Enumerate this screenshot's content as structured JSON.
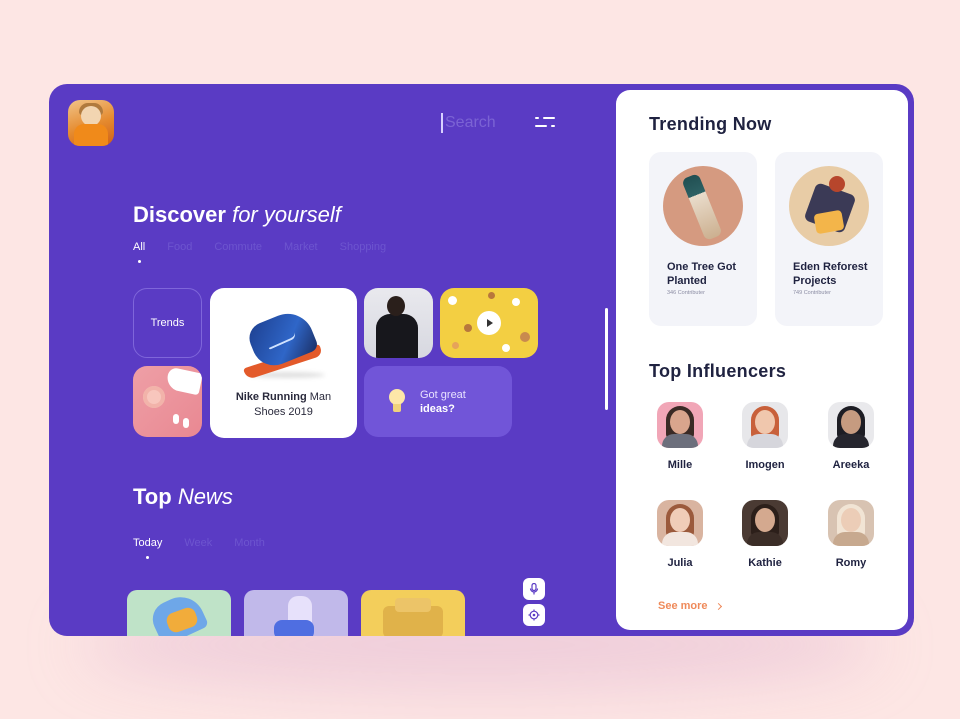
{
  "search": {
    "placeholder": "Search"
  },
  "discover": {
    "title_bold": "Discover",
    "title_italic": "for yourself",
    "tabs": [
      "All",
      "Food",
      "Commute",
      "Market",
      "Shopping"
    ],
    "active_tab": "All"
  },
  "cards": {
    "trends_label": "Trends",
    "nike_bold": "Nike Running",
    "nike_rest": "Man Shoes 2019",
    "ideas_line1": "Got great",
    "ideas_line2": "ideas?"
  },
  "news": {
    "title_bold": "Top",
    "title_italic": "News",
    "tabs": [
      "Today",
      "Week",
      "Month"
    ],
    "active_tab": "Today"
  },
  "panel": {
    "trending_title": "Trending Now",
    "trending": [
      {
        "name": "One Tree Got Planted",
        "sub": "346 Contributer"
      },
      {
        "name": "Eden Reforest Projects",
        "sub": "749 Contributer"
      }
    ],
    "influencers_title": "Top Influencers",
    "influencers": [
      {
        "name": "Mille"
      },
      {
        "name": "Imogen"
      },
      {
        "name": "Areeka"
      },
      {
        "name": "Julia"
      },
      {
        "name": "Kathie"
      },
      {
        "name": "Romy"
      }
    ],
    "see_more": "See more"
  },
  "colors": {
    "accent_purple": "#5a3bc4",
    "accent_orange": "#ef8a5a",
    "background": "#fde6e4"
  },
  "icons": [
    "avatar",
    "filter-icon",
    "play-icon",
    "bulb-icon",
    "mic-icon",
    "target-icon",
    "chevron-right-icon"
  ]
}
